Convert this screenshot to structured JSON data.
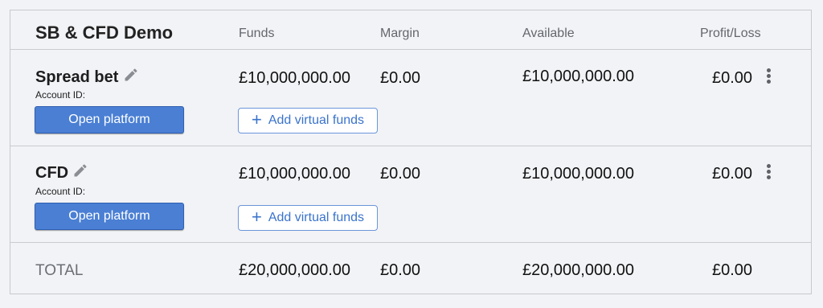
{
  "header": {
    "title": "SB & CFD Demo",
    "columns": {
      "funds": "Funds",
      "margin": "Margin",
      "available": "Available",
      "profit_loss": "Profit/Loss"
    }
  },
  "accounts": [
    {
      "name": "Spread bet",
      "account_id_label": "Account ID:",
      "funds": "£10,000,000.00",
      "margin": "£0.00",
      "available": "£10,000,000.00",
      "profit_loss": "£0.00",
      "open_label": "Open platform",
      "add_funds_label": "Add virtual funds"
    },
    {
      "name": "CFD",
      "account_id_label": "Account ID:",
      "funds": "£10,000,000.00",
      "margin": "£0.00",
      "available": "£10,000,000.00",
      "profit_loss": "£0.00",
      "open_label": "Open platform",
      "add_funds_label": "Add virtual funds"
    }
  ],
  "total": {
    "label": "TOTAL",
    "funds": "£20,000,000.00",
    "margin": "£0.00",
    "available": "£20,000,000.00",
    "profit_loss": "£0.00"
  },
  "icons": {
    "edit": "pencil-icon",
    "more": "kebab-menu-icon",
    "add": "plus-icon"
  },
  "colors": {
    "primary_button": "#4a7fd4",
    "link_blue": "#3a73cc"
  }
}
